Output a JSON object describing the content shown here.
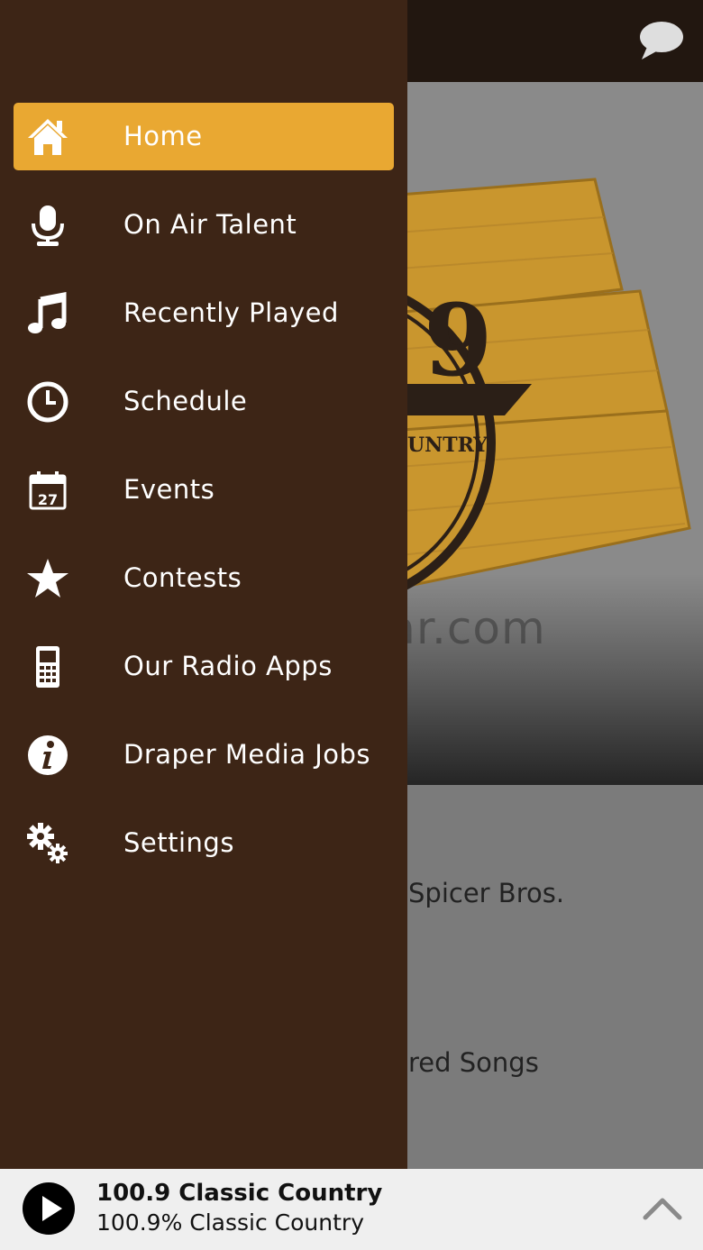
{
  "drawer": {
    "items": [
      {
        "label": "Home",
        "icon": "home-icon",
        "active": true
      },
      {
        "label": "On Air Talent",
        "icon": "microphone-icon"
      },
      {
        "label": "Recently Played",
        "icon": "music-note-icon"
      },
      {
        "label": "Schedule",
        "icon": "clock-icon"
      },
      {
        "label": "Events",
        "icon": "calendar-icon",
        "calendar_day": "27"
      },
      {
        "label": "Contests",
        "icon": "star-icon"
      },
      {
        "label": "Our Radio Apps",
        "icon": "phone-icon"
      },
      {
        "label": "Draper Media Jobs",
        "icon": "info-icon"
      },
      {
        "label": "Settings",
        "icon": "gears-icon"
      }
    ]
  },
  "background": {
    "logo_text": "9",
    "logo_banner": "UNTRY",
    "line1": "Spicer Bros.",
    "line2": "red Songs",
    "watermark": "UpdateStar.com"
  },
  "player": {
    "station_name": "100.9 Classic Country",
    "station_subtitle": "100.9% Classic Country"
  },
  "colors": {
    "drawer_bg": "#3d2516",
    "active_item": "#e9a832",
    "header_bg": "#221710",
    "player_bg": "#efefef"
  }
}
